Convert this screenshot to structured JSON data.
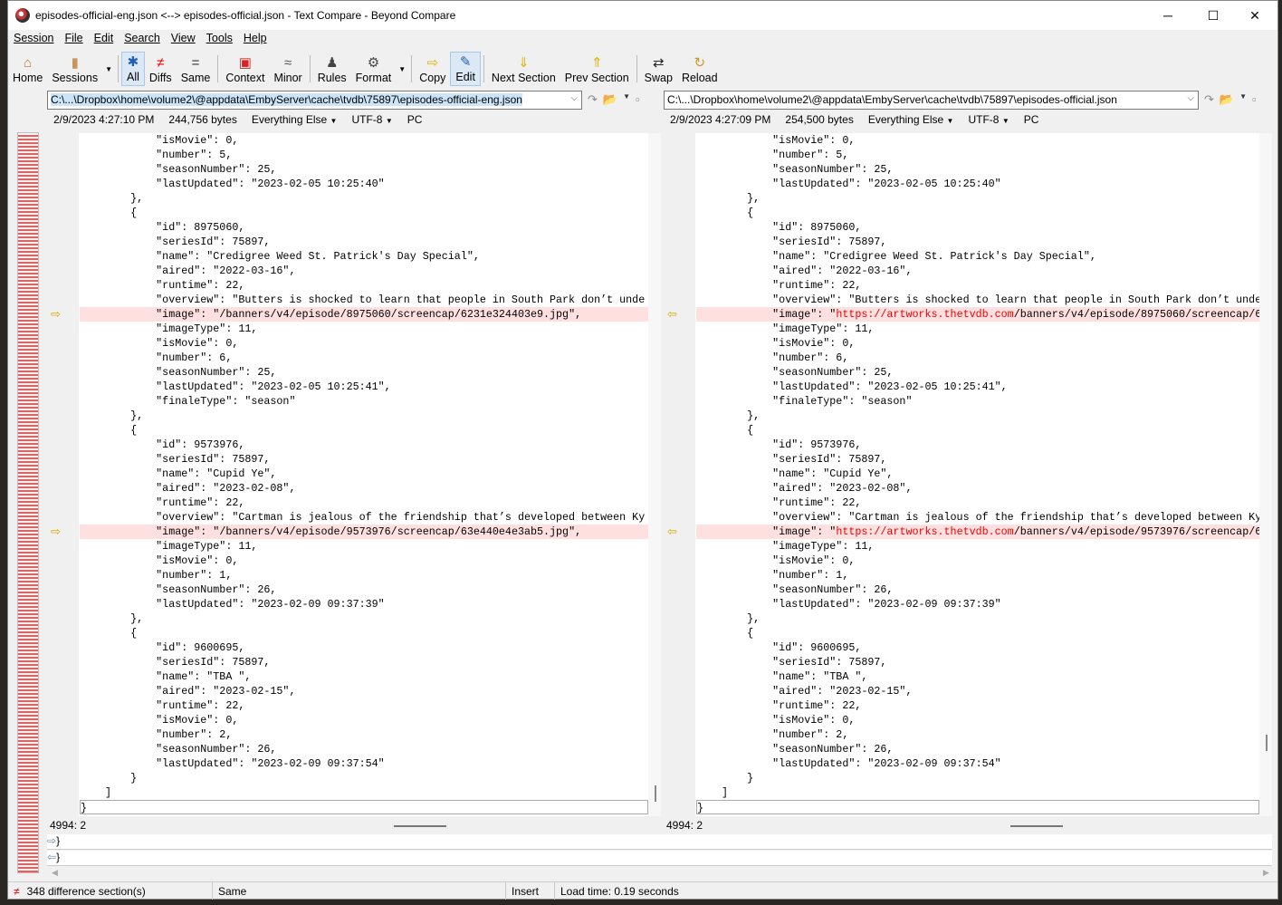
{
  "window": {
    "title": "episodes-official-eng.json <--> episodes-official.json - Text Compare - Beyond Compare",
    "min": "─",
    "max": "☐",
    "close": "✕"
  },
  "menu": [
    "Session",
    "File",
    "Edit",
    "Search",
    "View",
    "Tools",
    "Help"
  ],
  "toolbar": [
    {
      "label": "Home",
      "icon": "⌂",
      "name": "home",
      "color": "#b07a3a"
    },
    {
      "label": "Sessions",
      "icon": "▮",
      "name": "sessions",
      "color": "#c8955a",
      "dd": true
    },
    {
      "sep": true
    },
    {
      "label": "All",
      "icon": "✱",
      "name": "all",
      "color": "#1d5fb5",
      "active": true
    },
    {
      "label": "Diffs",
      "icon": "≠",
      "name": "diffs",
      "color": "#e00"
    },
    {
      "label": "Same",
      "icon": "=",
      "name": "same",
      "color": "#333"
    },
    {
      "sep": true
    },
    {
      "label": "Context",
      "icon": "▣",
      "name": "context",
      "color": "#d22"
    },
    {
      "label": "Minor",
      "icon": "≈",
      "name": "minor",
      "color": "#555"
    },
    {
      "sep": true
    },
    {
      "label": "Rules",
      "icon": "♟",
      "name": "rules",
      "color": "#444"
    },
    {
      "label": "Format",
      "icon": "⚙",
      "name": "format",
      "color": "#444",
      "dd": true
    },
    {
      "sep": true
    },
    {
      "label": "Copy",
      "icon": "⇨",
      "name": "copy",
      "color": "#e0b000"
    },
    {
      "label": "Edit",
      "icon": "✎",
      "name": "edit",
      "color": "#1d5fb5",
      "active": true
    },
    {
      "sep": true
    },
    {
      "label": "Next Section",
      "icon": "⇓",
      "name": "next-section",
      "color": "#e0b000"
    },
    {
      "label": "Prev Section",
      "icon": "⇑",
      "name": "prev-section",
      "color": "#e0b000"
    },
    {
      "sep": true
    },
    {
      "label": "Swap",
      "icon": "⇄",
      "name": "swap",
      "color": "#222"
    },
    {
      "label": "Reload",
      "icon": "↻",
      "name": "reload",
      "color": "#c89a2a"
    }
  ],
  "left": {
    "path": "C:\\...\\Dropbox\\home\\volume2\\@appdata\\EmbyServer\\cache\\tvdb\\75897\\episodes-official-eng.json",
    "date": "2/9/2023 4:27:10 PM",
    "size": "244,756 bytes",
    "format": "Everything Else",
    "encoding": "UTF-8",
    "lineend": "PC",
    "position": "4994: 2"
  },
  "right": {
    "path": "C:\\...\\Dropbox\\home\\volume2\\@appdata\\EmbyServer\\cache\\tvdb\\75897\\episodes-official.json",
    "date": "2/9/2023 4:27:09 PM",
    "size": "254,500 bytes",
    "format": "Everything Else",
    "encoding": "UTF-8",
    "lineend": "PC",
    "position": "4994: 2"
  },
  "lines_common": [
    "            \"isMovie\": 0,",
    "            \"number\": 5,",
    "            \"seasonNumber\": 25,",
    "            \"lastUpdated\": \"2023-02-05 10:25:40\"",
    "        },",
    "        {",
    "            \"id\": 8975060,",
    "            \"seriesId\": 75897,",
    "            \"name\": \"Credigree Weed St. Patrick's Day Special\",",
    "            \"aired\": \"2022-03-16\",",
    "            \"runtime\": 22,",
    "            \"overview\": \"Butters is shocked to learn that people in South Park don’t unde",
    "@DIFF0",
    "            \"imageType\": 11,",
    "            \"isMovie\": 0,",
    "            \"number\": 6,",
    "            \"seasonNumber\": 25,",
    "            \"lastUpdated\": \"2023-02-05 10:25:41\",",
    "            \"finaleType\": \"season\"",
    "        },",
    "        {",
    "            \"id\": 9573976,",
    "            \"seriesId\": 75897,",
    "            \"name\": \"Cupid Ye\",",
    "            \"aired\": \"2023-02-08\",",
    "            \"runtime\": 22,",
    "            \"overview\": \"Cartman is jealous of the friendship that’s developed between Ky",
    "@DIFF1",
    "            \"imageType\": 11,",
    "            \"isMovie\": 0,",
    "            \"number\": 1,",
    "            \"seasonNumber\": 26,",
    "            \"lastUpdated\": \"2023-02-09 09:37:39\"",
    "        },",
    "        {",
    "            \"id\": 9600695,",
    "            \"seriesId\": 75897,",
    "            \"name\": \"TBA \",",
    "            \"aired\": \"2023-02-15\",",
    "            \"runtime\": 22,",
    "            \"isMovie\": 0,",
    "            \"number\": 2,",
    "            \"seasonNumber\": 26,",
    "            \"lastUpdated\": \"2023-02-09 09:37:54\"",
    "        }",
    "    ]",
    "}"
  ],
  "diffs_left": [
    [
      "            \"image\": \"",
      "",
      "/banners/v4/episode/8975060/screencap/6231e324403e9.jpg\","
    ],
    [
      "            \"image\": \"",
      "",
      "/banners/v4/episode/9573976/screencap/63e440e4e3ab5.jpg\","
    ]
  ],
  "diffs_right": [
    [
      "            \"image\": \"",
      "https://artworks.thetvdb.com",
      "/banners/v4/episode/8975060/screencap/6"
    ],
    [
      "            \"image\": \"",
      "https://artworks.thetvdb.com",
      "/banners/v4/episode/9573976/screencap/6"
    ]
  ],
  "lower": {
    "left_line": "}",
    "right_line": "}"
  },
  "status": {
    "diffs": "348 difference section(s)",
    "filter": "Same",
    "mode": "Insert",
    "load": "Load time: 0.19 seconds"
  }
}
